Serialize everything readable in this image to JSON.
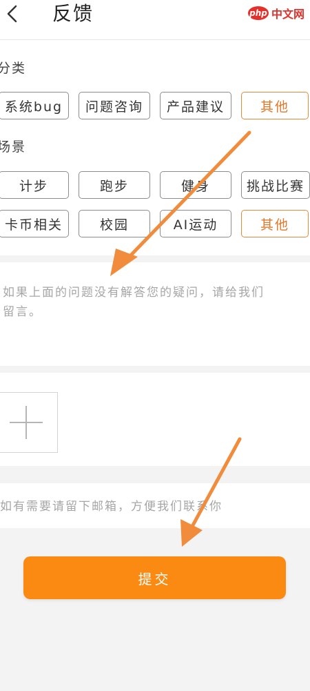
{
  "header": {
    "title": "反馈",
    "back_icon": "chevron-left-icon"
  },
  "watermark": {
    "logo": "php",
    "text": "中文网"
  },
  "category": {
    "label": "分类",
    "options": [
      "系统bug",
      "问题咨询",
      "产品建议",
      "其他"
    ],
    "selected": "其他"
  },
  "scene": {
    "label": "场景",
    "options": [
      "计步",
      "跑步",
      "健身",
      "挑战比赛",
      "卡币相关",
      "校园",
      "AI运动",
      "其他"
    ],
    "selected": "其他"
  },
  "feedback": {
    "placeholder_line1": "如果上面的问题没有解答您的疑问，请给我们",
    "placeholder_line2": "留言。"
  },
  "photo": {
    "add_icon": "plus-icon"
  },
  "email": {
    "placeholder": "如有需要请留下邮箱，方便我们联系你"
  },
  "submit": {
    "label": "提交"
  },
  "colors": {
    "accent": "#fb8a12",
    "selected": "#e0782a",
    "annotation_arrow": "#f08c3c"
  }
}
